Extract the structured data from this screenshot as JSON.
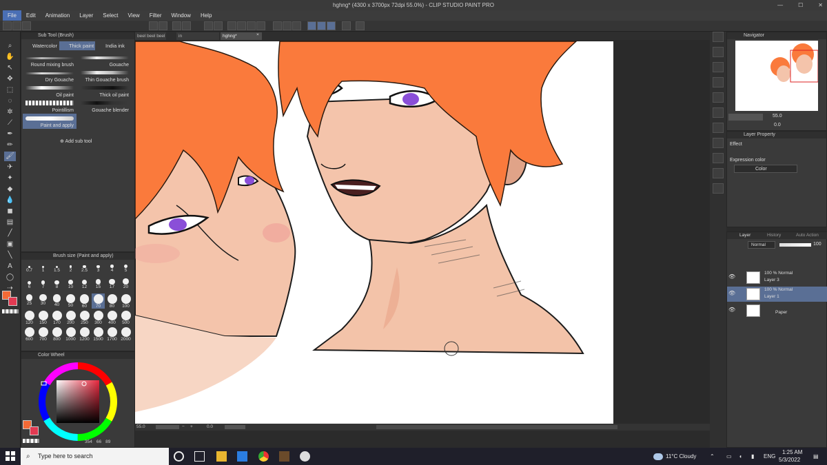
{
  "window": {
    "title": "hghng* (4300 x 3700px 72dpi 55.0%) - CLIP STUDIO PAINT PRO",
    "controls": [
      "—",
      "☐",
      "✕"
    ]
  },
  "menu": [
    "File",
    "Edit",
    "Animation",
    "Layer",
    "Select",
    "View",
    "Filter",
    "Window",
    "Help"
  ],
  "subtool_panel": {
    "title": "Sub Tool (Brush)",
    "tabs": [
      "Watercolor",
      "Thick paint",
      "India ink"
    ],
    "selected_tab": "Thick paint",
    "brushes": [
      "Round mixing brush",
      "Gouache",
      "Dry Gouache",
      "Thin Gouache brush",
      "Oil paint",
      "Thick oil paint",
      "Pointillism",
      "Gouache blender",
      "Paint and apply"
    ],
    "selected_brush": "Paint and apply",
    "add_label": "Add sub tool"
  },
  "brush_size_panel": {
    "title": "Brush size (Paint and apply)",
    "sizes": [
      "0.7",
      "1",
      "1.5",
      "2",
      "2.5",
      "3",
      "4",
      "5",
      "6",
      "7",
      "8",
      "10",
      "12",
      "15",
      "17",
      "20",
      "25",
      "30",
      "40",
      "50",
      "60",
      "70",
      "80",
      "100",
      "120",
      "150",
      "170",
      "200",
      "250",
      "300",
      "400",
      "500",
      "600",
      "700",
      "800",
      "1000",
      "1200",
      "1500",
      "1700",
      "2000"
    ],
    "selected": "70"
  },
  "color_wheel_panel": {
    "title": "Color Wheel",
    "values": {
      "h": "354",
      "s": "66",
      "v": "89"
    },
    "main_color": "#f26a36",
    "sub_color": "#e33a52"
  },
  "document_tabs": [
    "beel beel beel",
    "in",
    "hghng*"
  ],
  "selected_doc": "hghng*",
  "status": {
    "zoom": "55.0",
    "angle": "0.0"
  },
  "navigator": {
    "title": "Navigator",
    "zoom": "55.0",
    "angle": "0.0"
  },
  "layer_property": {
    "title": "Layer Property",
    "effect_label": "Effect",
    "expression_label": "Expression color",
    "expression_value": "Color"
  },
  "layer_panel": {
    "tabs": [
      "Layer",
      "History",
      "Auto Action"
    ],
    "blend_mode": "Normal",
    "opacity": "100",
    "layers": [
      {
        "mode": "100 % Normal",
        "name": "Layer 3"
      },
      {
        "mode": "100 % Normal",
        "name": "Layer 1"
      },
      {
        "mode": "",
        "name": "Paper"
      }
    ],
    "selected_layer": "Layer 1"
  },
  "taskbar": {
    "search_placeholder": "Type here to search",
    "weather": "11°C  Cloudy",
    "lang": "ENG",
    "time": "1:25 AM",
    "date": "5/3/2022"
  },
  "colors": {
    "accent": "#5a6f95",
    "hair": "#fa7a3c",
    "skin": "#f2bfa6",
    "eye": "#8a4fd8"
  }
}
